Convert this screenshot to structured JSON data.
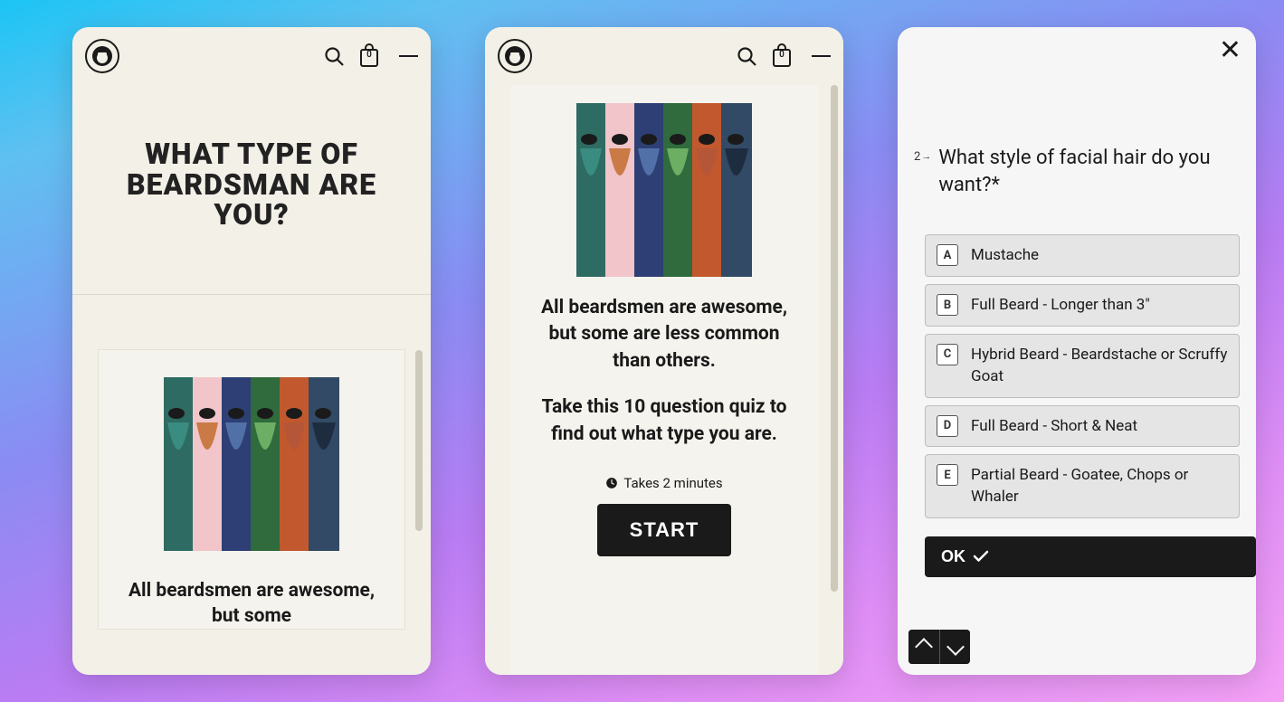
{
  "header": {
    "cart_count": "0"
  },
  "phone1": {
    "title": "WHAT TYPE OF BEARDSMAN ARE YOU?",
    "desc_a": "All beardsmen are awesome, but some"
  },
  "phone2": {
    "desc_1": "All beardsmen are awesome, but some are less common than others.",
    "desc_2": "Take this 10 question quiz to find out what type you are.",
    "takes": "Takes 2 minutes",
    "start": "START"
  },
  "phone3": {
    "q_num": "2",
    "question": "What style of facial hair do you want?*",
    "options": [
      {
        "key": "A",
        "label": "Mustache"
      },
      {
        "key": "B",
        "label": "Full Beard - Longer than 3\""
      },
      {
        "key": "C",
        "label": "Hybrid Beard - Beardstache or Scruffy Goat"
      },
      {
        "key": "D",
        "label": "Full Beard - Short & Neat"
      },
      {
        "key": "E",
        "label": "Partial Beard - Goatee, Chops or Whaler"
      }
    ],
    "ok": "OK"
  }
}
